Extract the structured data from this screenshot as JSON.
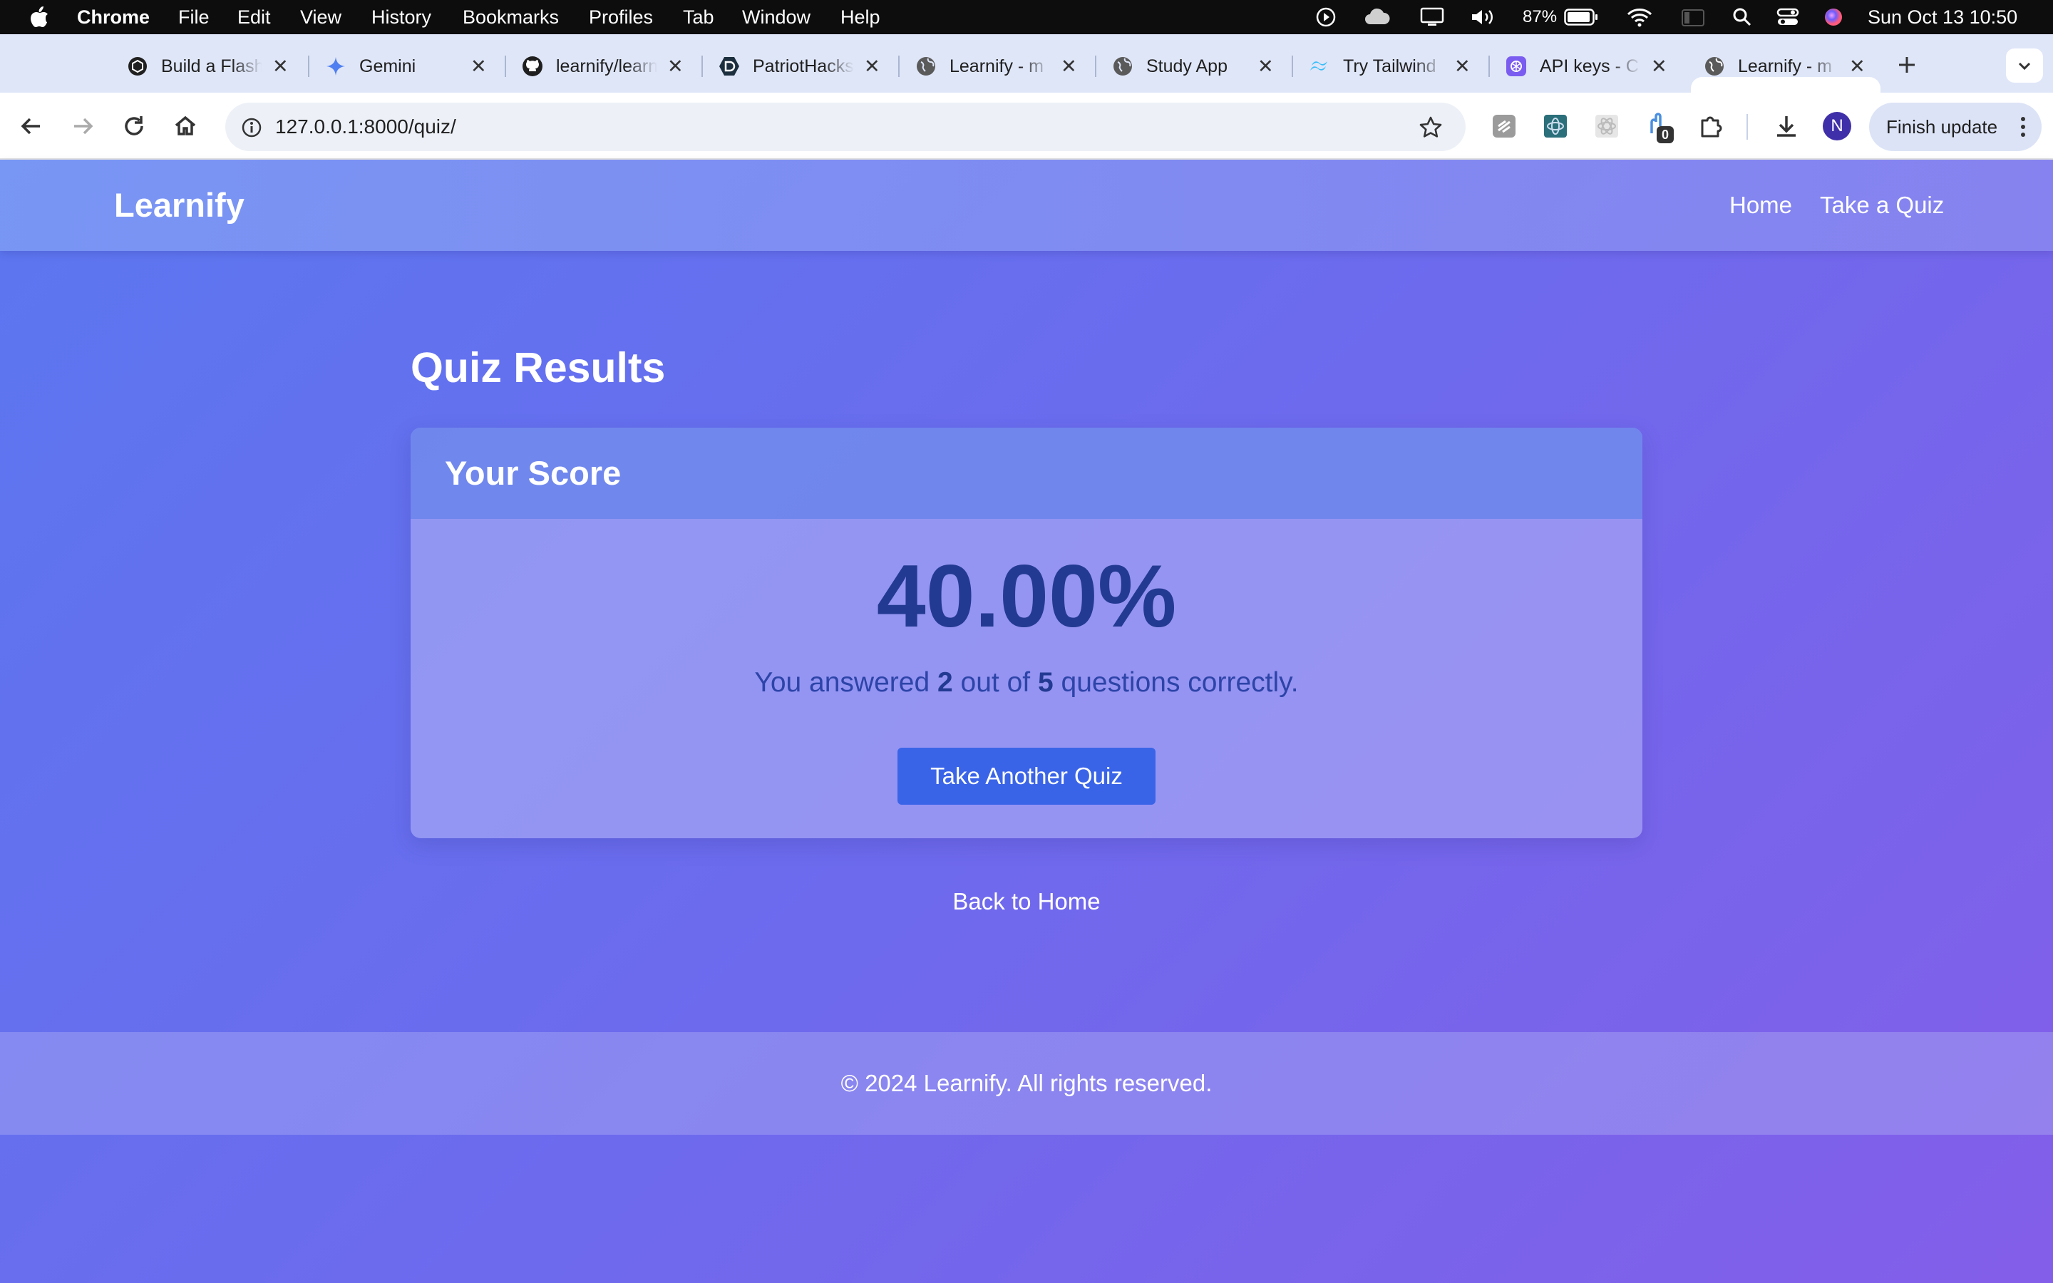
{
  "menubar": {
    "app": "Chrome",
    "items": [
      "File",
      "Edit",
      "View",
      "History",
      "Bookmarks",
      "Profiles",
      "Tab",
      "Window",
      "Help"
    ],
    "battery": "87%",
    "clock": "Sun Oct 13  10:50"
  },
  "tabs": [
    {
      "title": "Build a Flashcard",
      "icon": "chatgpt-icon"
    },
    {
      "title": "Gemini",
      "icon": "gemini-icon"
    },
    {
      "title": "learnify/learnify",
      "icon": "github-icon"
    },
    {
      "title": "PatriotHacks",
      "icon": "devpost-icon"
    },
    {
      "title": "Learnify - m",
      "icon": "globe-icon"
    },
    {
      "title": "Study App",
      "icon": "globe-icon"
    },
    {
      "title": "Try Tailwind",
      "icon": "tailwind-icon"
    },
    {
      "title": "API keys - C",
      "icon": "openai-icon"
    },
    {
      "title": "Learnify - m",
      "icon": "globe-icon"
    }
  ],
  "toolbar": {
    "url": "127.0.0.1:8000/quiz/",
    "extension_badge": "0",
    "profile_initial": "N",
    "finish_update": "Finish update"
  },
  "site": {
    "brand": "Learnify",
    "nav": [
      "Home",
      "Take a Quiz"
    ]
  },
  "results": {
    "title": "Quiz Results",
    "card_title": "Your Score",
    "score": "40.00%",
    "text_before": "You answered",
    "correct": "2",
    "text_mid": "out of",
    "total": "5",
    "text_after": "questions correctly.",
    "button": "Take Another Quiz",
    "back_link": "Back to Home"
  },
  "footer": {
    "text": "© 2024 Learnify. All rights reserved."
  },
  "colors": {
    "accent_button": "#3a64e8",
    "score_text": "#233a92",
    "profile": "#3f2fa8"
  }
}
